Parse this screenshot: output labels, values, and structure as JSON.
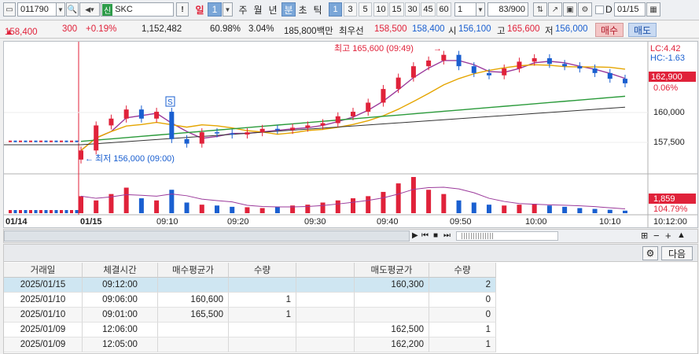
{
  "toolbar": {
    "code": "011790",
    "code_arrow": "▲",
    "badge": "신",
    "stock_name": "SKC",
    "alert_icon": "!",
    "period_label": "일",
    "period_num": "1",
    "periods": [
      "주",
      "월",
      "년",
      "분",
      "초",
      "틱"
    ],
    "intervals": [
      "1",
      "3",
      "5",
      "10",
      "15",
      "30",
      "45",
      "60"
    ],
    "unit_value": "1",
    "count_value": "83/900",
    "d_label": "D",
    "date_value": "01/15"
  },
  "quote": {
    "price": "158,400",
    "change": "300",
    "change_pct": "+0.19%",
    "volume": "1,152,482",
    "vol_ratio": "60.98%",
    "turnover_ratio": "3.04%",
    "amount": "185,800백만",
    "best_label": "최우선",
    "best_ask": "158,500",
    "best_bid": "158,400",
    "open_label": "시",
    "open": "156,100",
    "high_label": "고",
    "high": "165,600",
    "low_label": "저",
    "low": "156,000",
    "buy_label": "매수",
    "sell_label": "매도"
  },
  "chart": {
    "lc": "LC:4.42",
    "hc": "HC:-1.63",
    "high_annot": "최고 165,600 (09:49)",
    "low_annot": "최저 156,000 (09:00)",
    "signal": "S",
    "current_price": "162,900",
    "current_pct": "0.06%",
    "yticks": [
      "160,000",
      "157,500"
    ],
    "vol_current": "1,859",
    "vol_pct": "104.79%",
    "date_left": "01/14",
    "date_mid": "01/15",
    "xticks": [
      "09:10",
      "09:20",
      "09:30",
      "09:40",
      "09:50",
      "10:00",
      "10:10"
    ],
    "time_right": "10:12:00",
    "colors": {
      "up": "#e0223a",
      "down": "#1a5fd0",
      "ma5": "#9b3a9b",
      "ma20": "#e5a500",
      "ma60": "#2a9a3a",
      "ma120": "#333333"
    }
  },
  "chart_data": {
    "type": "candlestick",
    "x": [
      "09:00",
      "09:02",
      "09:04",
      "09:06",
      "09:08",
      "09:10",
      "09:12",
      "09:14",
      "09:16",
      "09:18",
      "09:20",
      "09:22",
      "09:24",
      "09:26",
      "09:28",
      "09:30",
      "09:32",
      "09:34",
      "09:36",
      "09:38",
      "09:40",
      "09:42",
      "09:44",
      "09:46",
      "09:48",
      "09:50",
      "09:52",
      "09:54",
      "09:56",
      "09:58",
      "10:00",
      "10:02",
      "10:04",
      "10:06",
      "10:08",
      "10:10",
      "10:12"
    ],
    "close": [
      157000,
      159200,
      159800,
      160600,
      159800,
      160400,
      158000,
      157600,
      158600,
      158500,
      158400,
      158600,
      158900,
      158800,
      159000,
      159200,
      159400,
      160000,
      160400,
      161200,
      162400,
      163400,
      164400,
      164900,
      165400,
      164400,
      163800,
      163600,
      164200,
      164800,
      165100,
      164600,
      164400,
      164200,
      163800,
      163300,
      162900
    ],
    "ylim": [
      155500,
      166000
    ],
    "volume": [
      40,
      30,
      45,
      60,
      35,
      30,
      55,
      25,
      20,
      18,
      15,
      14,
      12,
      15,
      18,
      20,
      25,
      30,
      35,
      40,
      50,
      70,
      85,
      55,
      45,
      30,
      25,
      20,
      18,
      20,
      22,
      18,
      15,
      12,
      10,
      8,
      6
    ]
  },
  "controls": {
    "zoom": [
      "−",
      "+"
    ],
    "layout": "▲"
  },
  "table": {
    "next_label": "다음",
    "headers": [
      "거래일",
      "체결시간",
      "매수평균가",
      "수량",
      "",
      "매도평균가",
      "수량"
    ],
    "rows": [
      [
        "2025/01/15",
        "09:12:00",
        "",
        "",
        "",
        "160,300",
        "2"
      ],
      [
        "2025/01/10",
        "09:06:00",
        "160,600",
        "1",
        "",
        "",
        "0"
      ],
      [
        "2025/01/10",
        "09:01:00",
        "165,500",
        "1",
        "",
        "",
        "0"
      ],
      [
        "2025/01/09",
        "12:06:00",
        "",
        "",
        "",
        "162,500",
        "1"
      ],
      [
        "2025/01/09",
        "12:05:00",
        "",
        "",
        "",
        "162,200",
        "1"
      ]
    ]
  }
}
